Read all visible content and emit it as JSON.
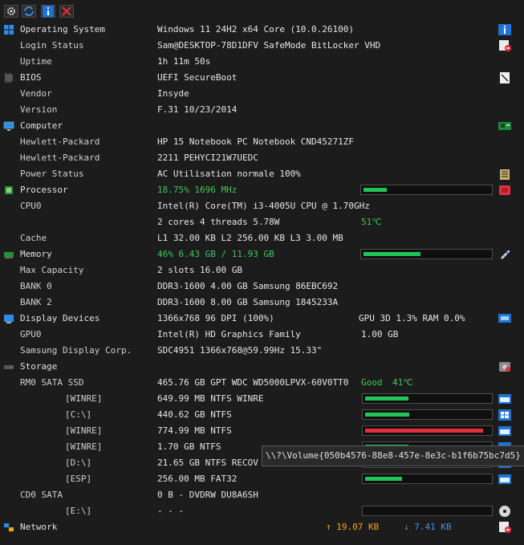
{
  "toolbar": {
    "buttons": [
      {
        "name": "gear-icon"
      },
      {
        "name": "refresh-icon"
      },
      {
        "name": "info-icon"
      },
      {
        "name": "close-icon"
      }
    ]
  },
  "rows": {
    "os": {
      "label": "Operating System",
      "value": "Windows 11 24H2 x64 Core (10.0.26100)"
    },
    "login": {
      "label": "Login Status",
      "value": "Sam@DESKTOP-78D1DFV SafeMode BitLocker VHD"
    },
    "uptime": {
      "label": "Uptime",
      "value": "1h 11m 50s"
    },
    "bios": {
      "label": "BIOS",
      "value": "UEFI SecureBoot"
    },
    "vendor": {
      "label": "Vendor",
      "value": "Insyde"
    },
    "version": {
      "label": "Version",
      "value": "F.31 10/23/2014"
    },
    "computer": {
      "label": "Computer"
    },
    "hp1": {
      "label": "Hewlett-Packard",
      "value": "HP 15 Notebook PC Notebook CND45271ZF"
    },
    "hp2": {
      "label": "Hewlett-Packard",
      "value": "2211 PEHYCI21W7UEDC"
    },
    "power": {
      "label": "Power Status",
      "value": "AC  Utilisation normale 100%"
    },
    "processor": {
      "label": "Processor",
      "value": "18.75% 1696 MHz",
      "load": 0.1875
    },
    "cpu0": {
      "label": "CPU0",
      "value": "Intel(R) Core(TM) i3-4005U CPU @ 1.70GHz"
    },
    "cpu0b": {
      "value": "2 cores 4 threads 5.78W",
      "temp": "51℃"
    },
    "cache": {
      "label": "Cache",
      "value": "L1 32.00 KB L2 256.00 KB L3 3.00 MB"
    },
    "memory": {
      "label": "Memory",
      "value": "46% 6.43 GB / 11.93 GB",
      "load": 0.46
    },
    "maxcap": {
      "label": "Max Capacity",
      "value": "2 slots 16.00 GB"
    },
    "bank0": {
      "label": "BANK 0",
      "value": "DDR3-1600 4.00 GB Samsung 86EBC692"
    },
    "bank2": {
      "label": "BANK 2",
      "value": "DDR3-1600 8.00 GB Samsung 1845233A"
    },
    "display": {
      "label": "Display Devices",
      "value": "1366x768 96 DPI (100%)",
      "extra": "GPU 3D 1.3% RAM 0.0%"
    },
    "gpu0": {
      "label": "GPU0",
      "value": "Intel(R) HD Graphics Family",
      "extra": "1.00 GB"
    },
    "samsung": {
      "label": "Samsung Display Corp.",
      "value": "SDC4951 1366x768@59.99Hz 15.33\""
    },
    "storage": {
      "label": "Storage"
    },
    "rm0": {
      "label": "RM0 SATA SSD",
      "value": "465.76 GB GPT WDC WD5000LPVX-60V0TT0",
      "health": "Good",
      "temp": "41℃"
    },
    "p1": {
      "label": "[WINRE]",
      "value": "649.99 MB NTFS WINRE",
      "usage": 0.35
    },
    "p2": {
      "label": "[C:\\]",
      "value": "440.62 GB NTFS",
      "usage": 0.36
    },
    "p3": {
      "label": "[WINRE]",
      "value": "774.99 MB NTFS",
      "usage": 0.96
    },
    "p4": {
      "label": "[WINRE]",
      "value": "1.70 GB NTFS",
      "usage": 0.35
    },
    "p5": {
      "label": "[D:\\]",
      "value": "21.65 GB NTFS RECOV",
      "usage": 0.3
    },
    "p6": {
      "label": "[ESP]",
      "value": "256.00 MB FAT32",
      "usage": 0.3
    },
    "cd0": {
      "label": "CD0 SATA",
      "value": "0 B - DVDRW  DU8A6SH"
    },
    "e": {
      "label": "[E:\\]",
      "value": "- - -",
      "usage": 0.0
    },
    "network": {
      "label": "Network",
      "up": "↑ 19.07 KB",
      "down": "↓ 7.41 KB"
    }
  },
  "tooltip": {
    "text": "\\\\?\\Volume{050b4576-88e8-457e-8e3c-b1f6b75bc7d5}"
  },
  "colors": {
    "good": "#3ec85a",
    "bar": "#20c55a",
    "bar_full": "#e23040",
    "upload": "#f2a71b",
    "download": "#4a90e2"
  }
}
